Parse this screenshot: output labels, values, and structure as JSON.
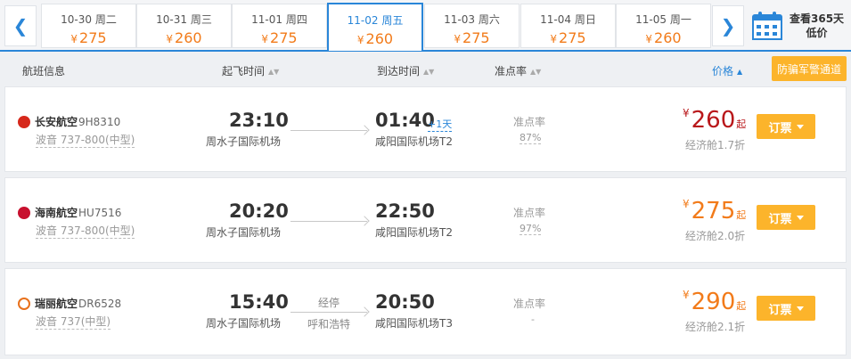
{
  "date_bar": {
    "prev_icon": "chevron-left-icon",
    "next_icon": "chevron-right-icon",
    "currency_symbol": "¥",
    "dates": [
      {
        "label": "10-30 周二",
        "price": "275"
      },
      {
        "label": "10-31 周三",
        "price": "260"
      },
      {
        "label": "11-01 周四",
        "price": "275"
      },
      {
        "label": "11-02 周五",
        "price": "260",
        "active": true
      },
      {
        "label": "11-03 周六",
        "price": "275"
      },
      {
        "label": "11-04 周日",
        "price": "275"
      },
      {
        "label": "11-05 周一",
        "price": "260"
      }
    ],
    "calendar_icon": "calendar-icon",
    "calendar_line1": "查看365天",
    "calendar_line2": "低价"
  },
  "header": {
    "flight_info": "航班信息",
    "depart_time": "起飞时间",
    "arrive_time": "到达时间",
    "ontime_rate": "准点率",
    "price": "价格",
    "anti_fraud_button": "防骗军警通道"
  },
  "flights": [
    {
      "airline": "长安航空",
      "flight_no": "9H8310",
      "plane": "波音 737-800(中型)",
      "dep_time": "23:10",
      "dep_airport": "周水子国际机场",
      "arr_time": "01:40",
      "arr_plus": "+1天",
      "arr_airport": "咸阳国际机场T2",
      "stop_label": "",
      "stop_city": "",
      "ontime_label": "准点率",
      "ontime_value": "87%",
      "currency": "¥",
      "price": "260",
      "price_suffix": "起",
      "cabin": "经济舱1.7折",
      "book_label": "订票"
    },
    {
      "airline": "海南航空",
      "flight_no": "HU7516",
      "plane": "波音 737-800(中型)",
      "dep_time": "20:20",
      "dep_airport": "周水子国际机场",
      "arr_time": "22:50",
      "arr_plus": "",
      "arr_airport": "咸阳国际机场T2",
      "stop_label": "",
      "stop_city": "",
      "ontime_label": "准点率",
      "ontime_value": "97%",
      "currency": "¥",
      "price": "275",
      "price_suffix": "起",
      "cabin": "经济舱2.0折",
      "book_label": "订票"
    },
    {
      "airline": "瑞丽航空",
      "flight_no": "DR6528",
      "plane": "波音 737(中型)",
      "dep_time": "15:40",
      "dep_airport": "周水子国际机场",
      "arr_time": "20:50",
      "arr_plus": "",
      "arr_airport": "咸阳国际机场T3",
      "stop_label": "经停",
      "stop_city": "呼和浩特",
      "ontime_label": "准点率",
      "ontime_value": "-",
      "currency": "¥",
      "price": "290",
      "price_suffix": "起",
      "cabin": "经济舱2.1折",
      "book_label": "订票"
    }
  ],
  "colors": {
    "accent": "#2a86d8",
    "price_orange": "#f27b1a",
    "price_lowest": "#b9181b",
    "button": "#fcb42b"
  }
}
